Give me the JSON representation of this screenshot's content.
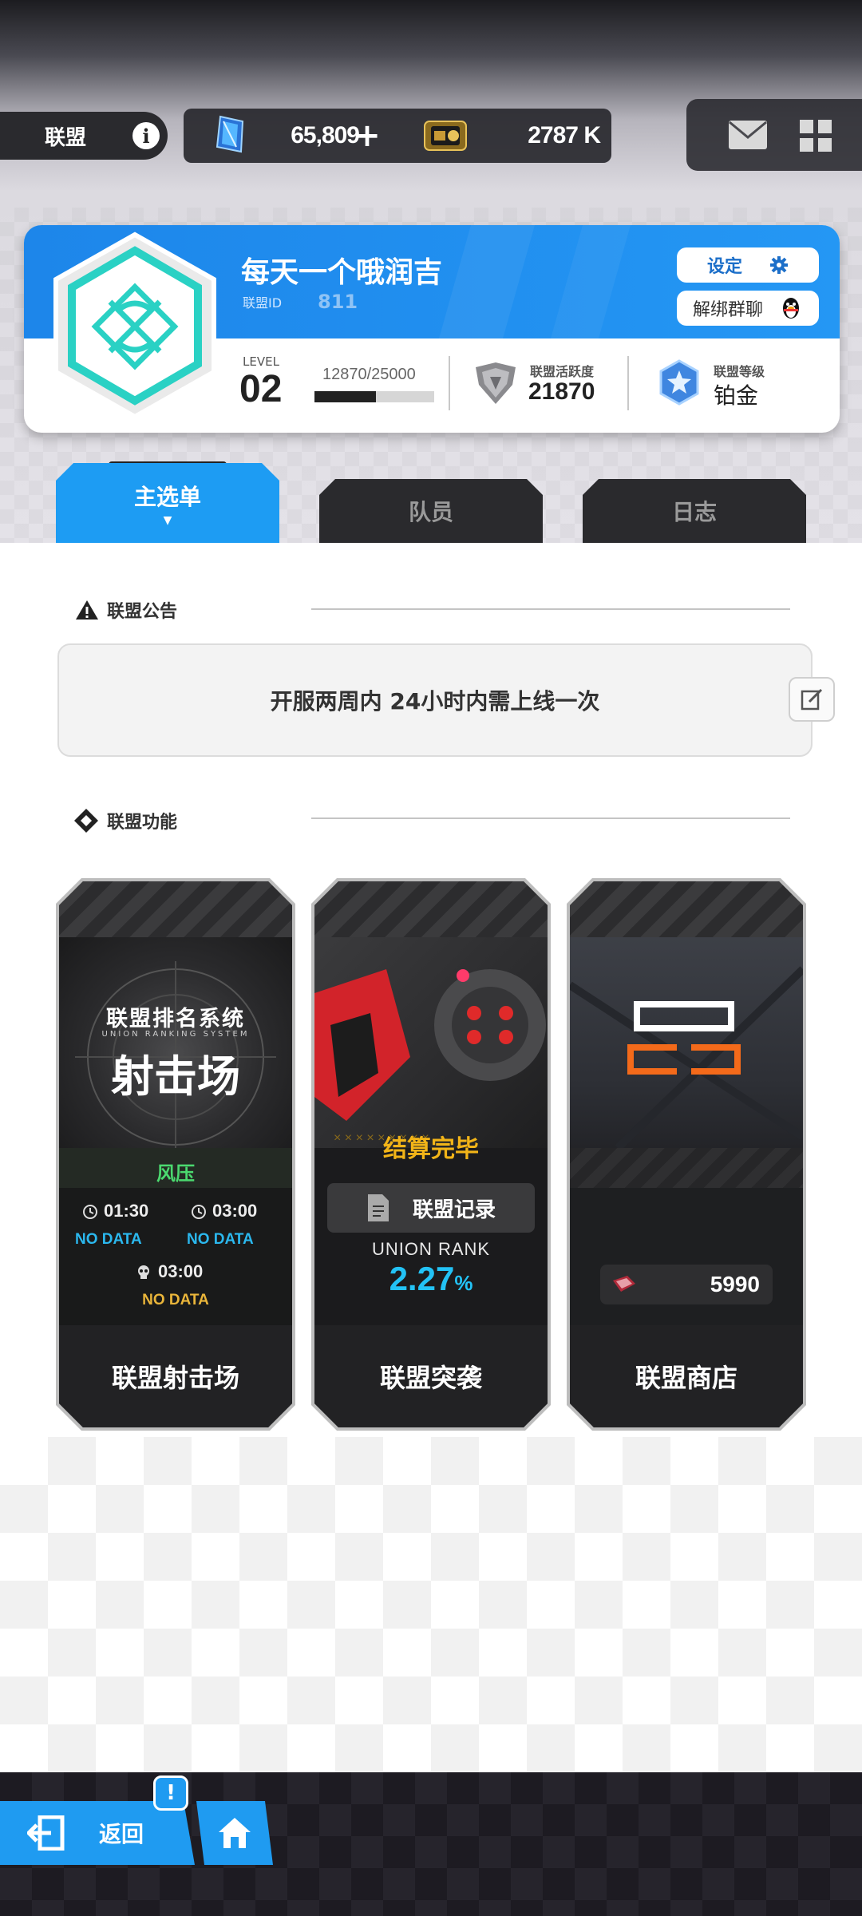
{
  "topbar": {
    "union_label": "联盟",
    "gems": "65,809",
    "gems_plus": "+",
    "coins": "2787 K"
  },
  "union": {
    "name": "每天一个哦润吉",
    "id_label": "联盟ID",
    "id_value": "811",
    "settings_label": "设定",
    "unbind_label": "解绑群聊",
    "level_label": "LEVEL",
    "level_value": "02",
    "exp_text": "12870/25000",
    "exp_progress": 0.5148,
    "activity_label": "联盟活跃度",
    "activity_value": "21870",
    "rank_label": "联盟等级",
    "rank_value": "铂金"
  },
  "tabs": [
    {
      "label": "主选单",
      "active": true
    },
    {
      "label": "队员",
      "active": false
    },
    {
      "label": "日志",
      "active": false
    }
  ],
  "notice": {
    "title": "联盟公告",
    "content": "开服两周内  24小时内需上线一次"
  },
  "features": {
    "title": "联盟功能",
    "range": {
      "title": "联盟射击场",
      "banner_cn": "联盟排名系统",
      "banner_en": "UNION RANKING SYSTEM",
      "banner_big": "射击场",
      "mode": "风压",
      "time1": "01:30",
      "time2": "03:00",
      "nodata1": "NO DATA",
      "nodata2": "NO DATA",
      "time3": "03:00",
      "nodata3": "NO DATA"
    },
    "raid": {
      "title": "联盟突袭",
      "status": "结算完毕",
      "record_label": "联盟记录",
      "rank_label": "UNION RANK",
      "rank_value": "2.27",
      "rank_unit": "%"
    },
    "shop": {
      "title": "联盟商店",
      "currency_value": "5990"
    }
  },
  "bottom": {
    "back_label": "返回",
    "alert_badge": "!"
  },
  "colors": {
    "accent": "#1d9cf3",
    "teal_emblem": "#2ad1c4",
    "raid_gold": "#f2b418",
    "rank_cyan": "#23c2f5"
  }
}
